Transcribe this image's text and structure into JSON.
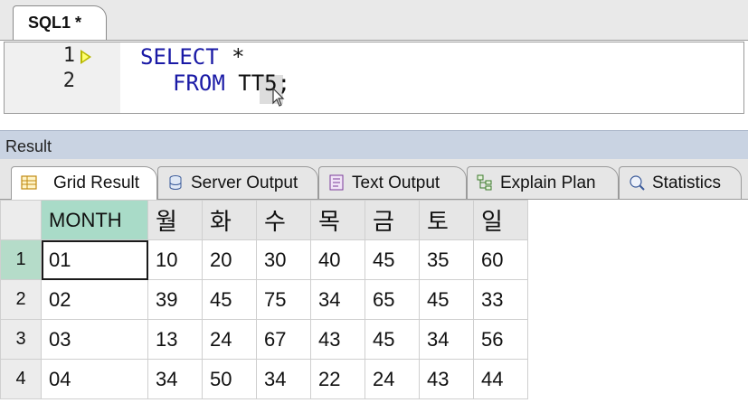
{
  "editor": {
    "tab_label": "SQL1 *",
    "lines": [
      {
        "number": "1",
        "keyword": "SELECT",
        "rest": " *"
      },
      {
        "number": "2",
        "keyword": "FROM",
        "rest": " TT5;"
      }
    ]
  },
  "result": {
    "title": "Result",
    "tabs": [
      {
        "label": "Grid Result",
        "icon": "grid-icon",
        "active": true
      },
      {
        "label": "Server Output",
        "icon": "server-output-icon"
      },
      {
        "label": "Text Output",
        "icon": "text-output-icon"
      },
      {
        "label": "Explain Plan",
        "icon": "explain-plan-icon"
      },
      {
        "label": "Statistics",
        "icon": "statistics-icon"
      }
    ],
    "columns": [
      "MONTH",
      "월",
      "화",
      "수",
      "목",
      "금",
      "토",
      "일"
    ],
    "rows": [
      {
        "num": "1",
        "cells": [
          "01",
          "10",
          "20",
          "30",
          "40",
          "45",
          "35",
          "60"
        ]
      },
      {
        "num": "2",
        "cells": [
          "02",
          "39",
          "45",
          "75",
          "34",
          "65",
          "45",
          "33"
        ]
      },
      {
        "num": "3",
        "cells": [
          "03",
          "13",
          "24",
          "67",
          "43",
          "45",
          "34",
          "56"
        ]
      },
      {
        "num": "4",
        "cells": [
          "04",
          "34",
          "50",
          "34",
          "22",
          "24",
          "43",
          "44"
        ]
      }
    ]
  },
  "colors": {
    "keyword": "#1a1aa6",
    "header_active": "#a9dbc8",
    "result_bar": "#c9d3e2"
  }
}
